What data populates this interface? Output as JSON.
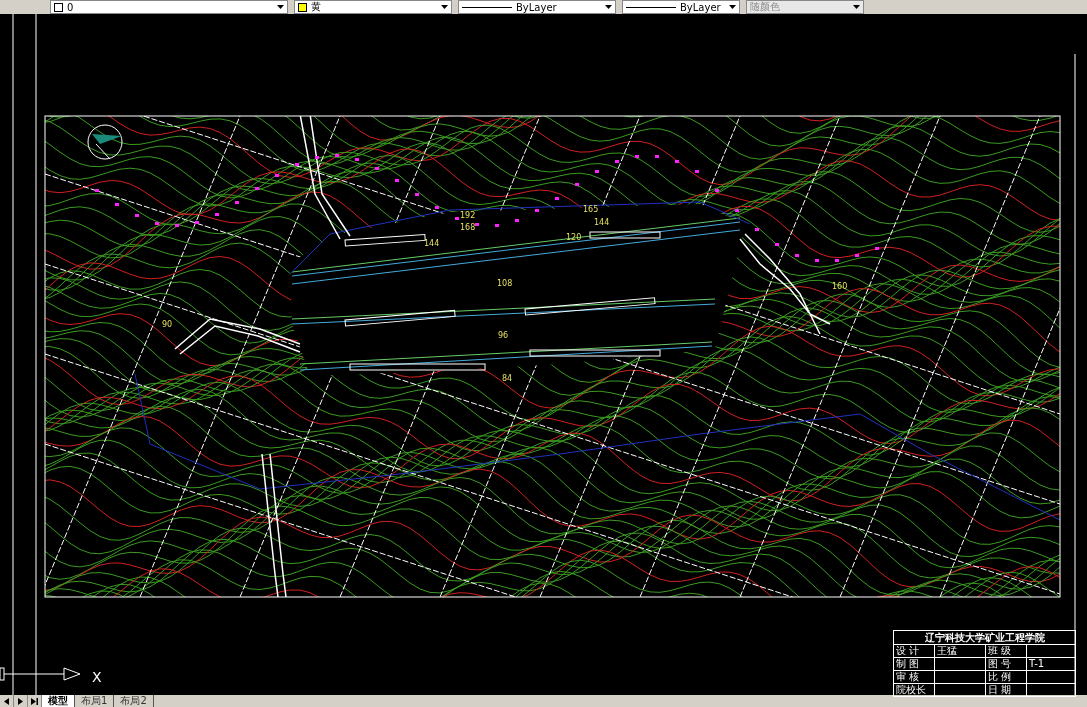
{
  "toolbar": {
    "layer": "0",
    "color_setting": "黄",
    "linetype": "ByLayer",
    "lineweight": "ByLayer",
    "plot_style": {
      "value": "随颜色",
      "disabled": true
    }
  },
  "drawing": {
    "elevation_labels": [
      "192",
      "168",
      "144",
      "165",
      "144",
      "120",
      "108",
      "96",
      "84",
      "90",
      "160"
    ],
    "ucs_axis_label": "X"
  },
  "title_block": {
    "title": "辽宁科技大学矿业工程学院",
    "rows": [
      {
        "label": "设 计",
        "value": "王猛",
        "field": "班 级"
      },
      {
        "label": "制 图",
        "field": "图 号",
        "field_value": "T-1"
      },
      {
        "label": "审 核",
        "field": "比 例"
      },
      {
        "label": "院校长",
        "field": "日 期"
      }
    ]
  },
  "tabs": [
    {
      "label": "模型",
      "selected": true
    },
    {
      "label": "布局1",
      "selected": false
    },
    {
      "label": "布局2",
      "selected": false
    }
  ]
}
